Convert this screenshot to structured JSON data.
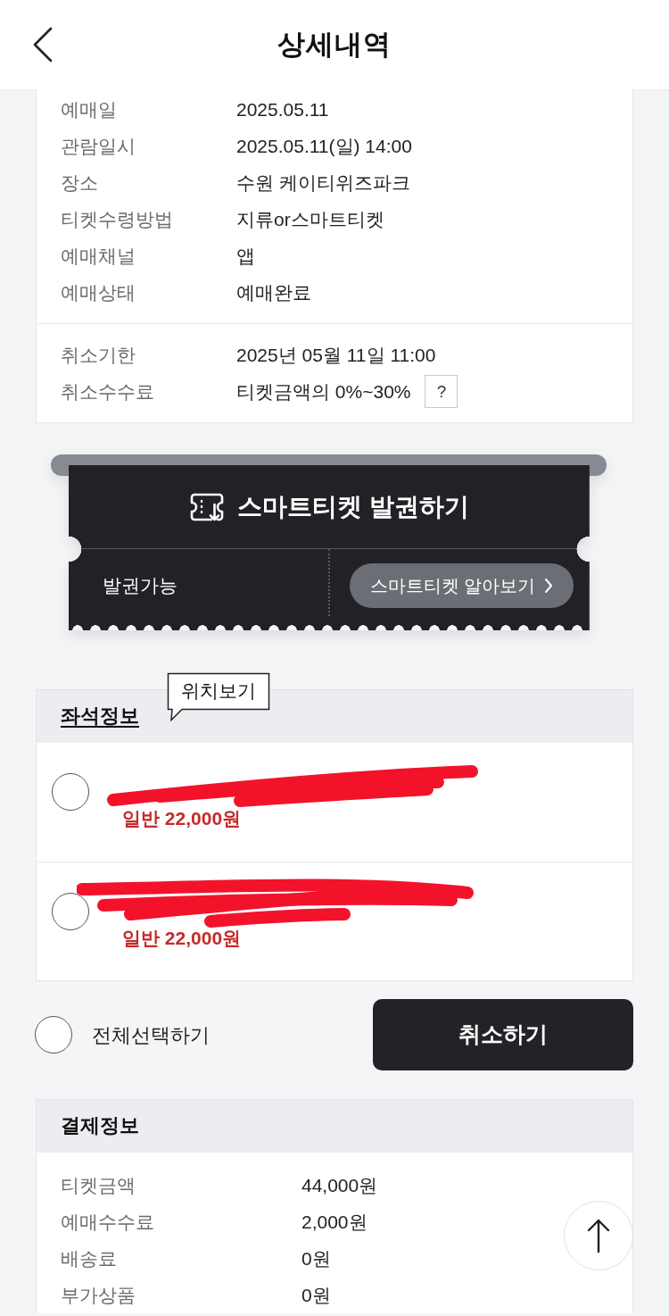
{
  "header": {
    "title": "상세내역"
  },
  "details": [
    {
      "label": "예매일",
      "value": "2025.05.11"
    },
    {
      "label": "관람일시",
      "value": "2025.05.11(일) 14:00"
    },
    {
      "label": "장소",
      "value": "수원 케이티위즈파크"
    },
    {
      "label": "티켓수령방법",
      "value": "지류or스마트티켓"
    },
    {
      "label": "예매채널",
      "value": "앱"
    },
    {
      "label": "예매상태",
      "value": "예매완료"
    }
  ],
  "cancel_terms": [
    {
      "label": "취소기한",
      "value": "2025년 05월 11일 11:00"
    },
    {
      "label": "취소수수료",
      "value": "티켓금액의 0%~30%",
      "help": "?"
    }
  ],
  "smart_ticket": {
    "title": "스마트티켓 발권하기",
    "status": "발권가능",
    "link": "스마트티켓 알아보기"
  },
  "seat_info": {
    "title": "좌석정보",
    "tooltip": "위치보기",
    "seats": [
      {
        "price": "일반 22,000원",
        "selected": false,
        "redacted": true
      },
      {
        "price": "일반 22,000원",
        "selected": false,
        "redacted": true
      }
    ]
  },
  "select_all": {
    "label": "전체선택하기",
    "selected": false
  },
  "cancel_button": "취소하기",
  "payment": {
    "title": "결제정보",
    "rows": [
      {
        "label": "티켓금액",
        "value": "44,000원"
      },
      {
        "label": "예매수수료",
        "value": "2,000원"
      },
      {
        "label": "배송료",
        "value": "0원"
      },
      {
        "label": "부가상품",
        "value": "0원"
      }
    ]
  }
}
